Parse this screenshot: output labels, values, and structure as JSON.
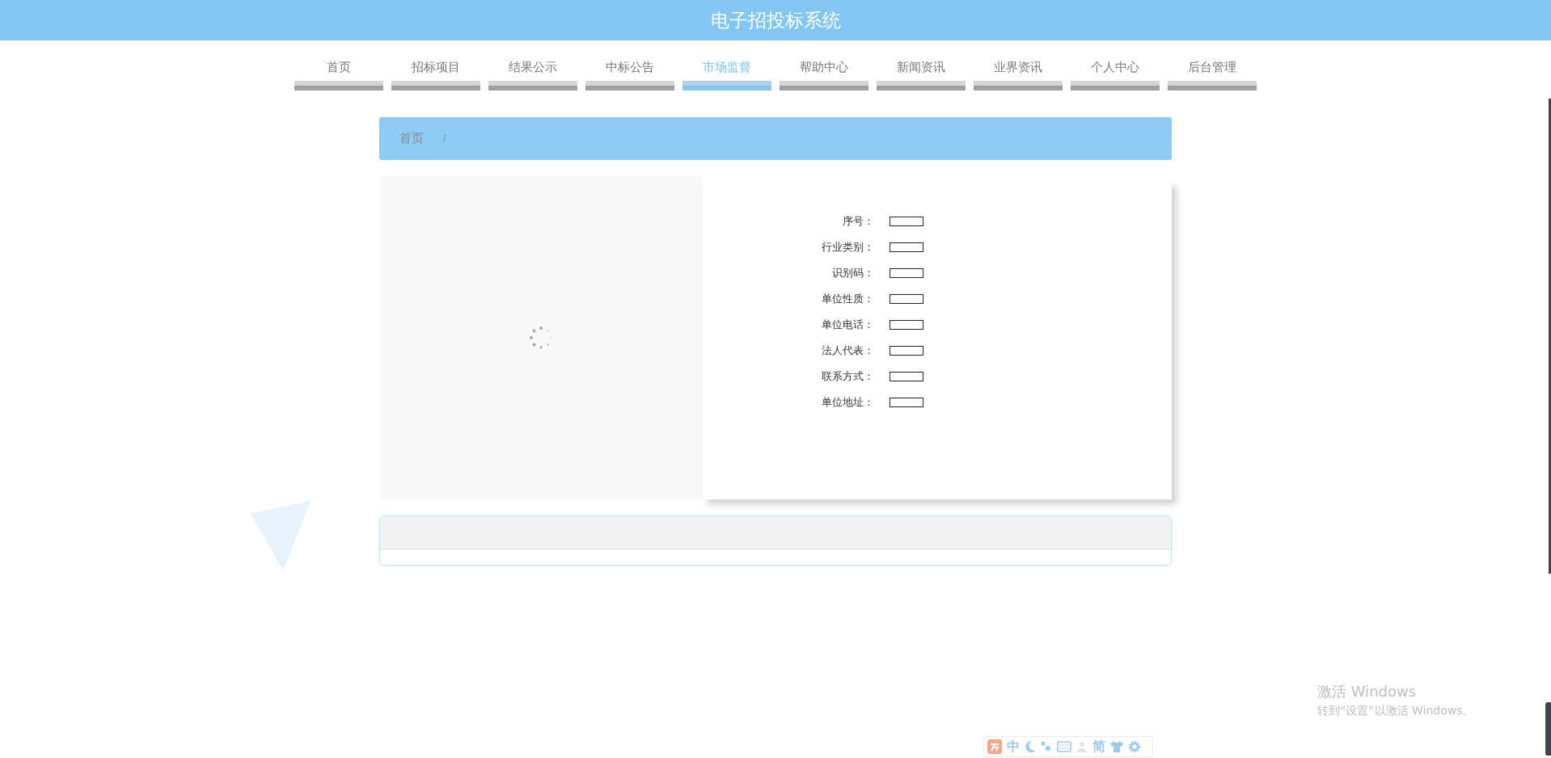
{
  "header": {
    "title": "电子招投标系统"
  },
  "nav": [
    {
      "label": "首页",
      "selected": false
    },
    {
      "label": "招标项目",
      "selected": false
    },
    {
      "label": "结果公示",
      "selected": false
    },
    {
      "label": "中标公告",
      "selected": false
    },
    {
      "label": "市场监督",
      "selected": true
    },
    {
      "label": "帮助中心",
      "selected": false
    },
    {
      "label": "新闻资讯",
      "selected": false
    },
    {
      "label": "业界资讯",
      "selected": false
    },
    {
      "label": "个人中心",
      "selected": false
    },
    {
      "label": "后台管理",
      "selected": false
    }
  ],
  "breadcrumb": {
    "items": [
      "首页"
    ],
    "separator": "/"
  },
  "detail": {
    "fields": [
      {
        "label": "序号："
      },
      {
        "label": "行业类别："
      },
      {
        "label": "识别码："
      },
      {
        "label": "单位性质："
      },
      {
        "label": "单位电话："
      },
      {
        "label": "法人代表："
      },
      {
        "label": "联系方式："
      },
      {
        "label": "单位地址："
      }
    ]
  },
  "activation_notice": {
    "title": "激活 Windows",
    "text": "转到“设置”以激活 Windows。"
  },
  "ime_toolbar": {
    "language": "中",
    "script": "简"
  }
}
